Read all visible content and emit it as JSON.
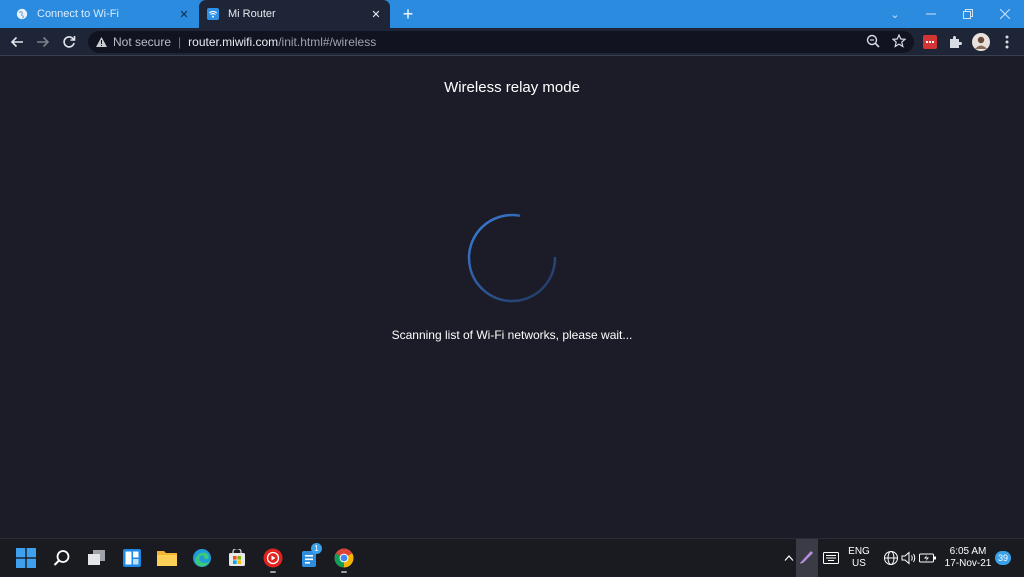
{
  "browser": {
    "tabs": [
      {
        "title": "Connect to Wi-Fi",
        "active": false,
        "favicon": "globe-icon"
      },
      {
        "title": "Mi Router",
        "active": true,
        "favicon": "wifi-icon"
      }
    ],
    "new_tab_label": "+",
    "address": {
      "security_label": "Not secure",
      "host": "router.miwifi.com",
      "path": "/init.html#/wireless"
    },
    "colors": {
      "tab_strip": "#2b8bdf",
      "toolbar": "#1e2536",
      "omnibox": "#111420"
    }
  },
  "page": {
    "title": "Wireless relay mode",
    "status": "Scanning list of Wi-Fi networks, please wait...",
    "background": "#1b1c28",
    "spinner_color": "#3b82e0"
  },
  "taskbar": {
    "language_line1": "ENG",
    "language_line2": "US",
    "time": "6:05 AM",
    "date": "17-Nov-21",
    "notification_count": "39",
    "store_badge": "1"
  }
}
